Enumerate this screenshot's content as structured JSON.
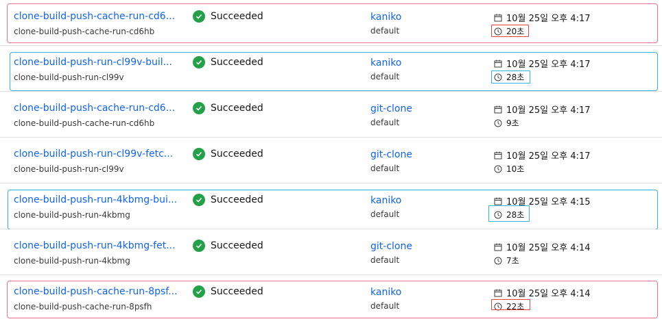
{
  "rows": [
    {
      "name": "clone-build-push-cache-run-cd6...",
      "subname": "clone-build-push-cache-run-cd6hb",
      "status": "Succeeded",
      "task": "kaniko",
      "namespace": "default",
      "time": "10월 25일 오후 4:17",
      "duration": "20초"
    },
    {
      "name": "clone-build-push-run-cl99v-buil...",
      "subname": "clone-build-push-run-cl99v",
      "status": "Succeeded",
      "task": "kaniko",
      "namespace": "default",
      "time": "10월 25일 오후 4:17",
      "duration": "28초"
    },
    {
      "name": "clone-build-push-cache-run-cd6...",
      "subname": "clone-build-push-cache-run-cd6hb",
      "status": "Succeeded",
      "task": "git-clone",
      "namespace": "default",
      "time": "10월 25일 오후 4:17",
      "duration": "9초"
    },
    {
      "name": "clone-build-push-run-cl99v-fetc...",
      "subname": "clone-build-push-run-cl99v",
      "status": "Succeeded",
      "task": "git-clone",
      "namespace": "default",
      "time": "10월 25일 오후 4:17",
      "duration": "10초"
    },
    {
      "name": "clone-build-push-run-4kbmg-bui...",
      "subname": "clone-build-push-run-4kbmg",
      "status": "Succeeded",
      "task": "kaniko",
      "namespace": "default",
      "time": "10월 25일 오후 4:15",
      "duration": "28초"
    },
    {
      "name": "clone-build-push-run-4kbmg-fet...",
      "subname": "clone-build-push-run-4kbmg",
      "status": "Succeeded",
      "task": "git-clone",
      "namespace": "default",
      "time": "10월 25일 오후 4:14",
      "duration": "7초"
    },
    {
      "name": "clone-build-push-cache-run-8psf...",
      "subname": "clone-build-push-cache-run-8psfh",
      "status": "Succeeded",
      "task": "kaniko",
      "namespace": "default",
      "time": "10월 25일 오후 4:14",
      "duration": "22초"
    }
  ],
  "highlight_colors": {
    "cache_run": "#e8718a",
    "no_cache_run": "#2fb3e0",
    "duration_box_cache": "#e0443e"
  },
  "status_color": "#24a148",
  "link_color": "#0f62fe"
}
